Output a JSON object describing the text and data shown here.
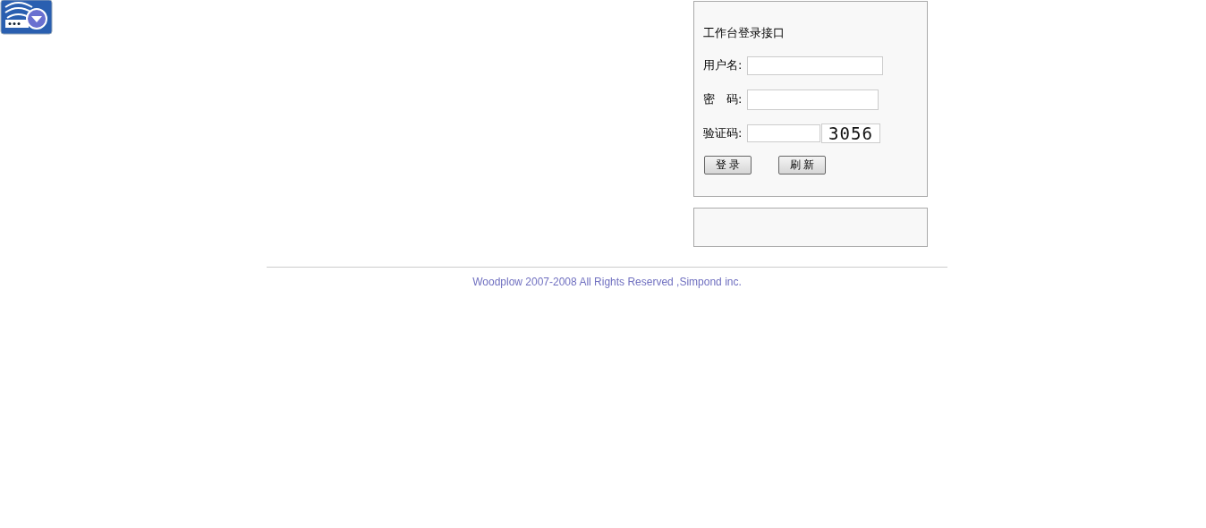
{
  "login_panel": {
    "title": "工作台登录接口",
    "fields": [
      {
        "kind": "text",
        "label": "用户名:"
      },
      {
        "kind": "password",
        "label": "密　码:"
      },
      {
        "kind": "captcha",
        "label": "验证码:",
        "captcha": "3056"
      }
    ],
    "buttons": [
      "登 录",
      "刷 新"
    ]
  },
  "footer": "Woodplow 2007-2008 All Rights Reserved ,Simpond inc."
}
